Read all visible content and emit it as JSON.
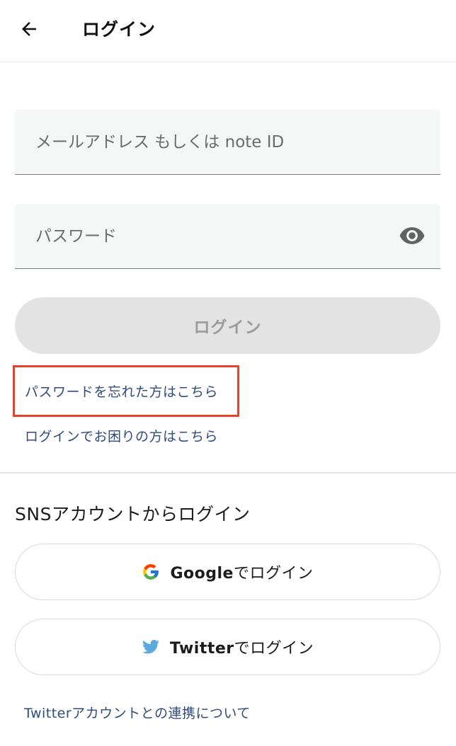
{
  "header": {
    "title": "ログイン"
  },
  "form": {
    "email_placeholder": "メールアドレス もしくは note ID",
    "password_placeholder": "パスワード",
    "login_label": "ログイン"
  },
  "links": {
    "forgot_password": "パスワードを忘れた方はこちら",
    "trouble_login": "ログインでお困りの方はこちら",
    "twitter_info": "Twitterアカウントとの連携について"
  },
  "sns": {
    "heading": "SNSアカウントからログイン",
    "google": {
      "brand": "Google",
      "suffix": "でログイン",
      "icon": "google-g-icon"
    },
    "twitter": {
      "brand": "Twitter",
      "suffix": "でログイン",
      "icon": "twitter-bird-icon"
    }
  },
  "colors": {
    "highlight": "#e6432e",
    "link": "#2f4b7d",
    "twitter": "#5ea9dd",
    "disabled_button": "#e3e3e3"
  }
}
